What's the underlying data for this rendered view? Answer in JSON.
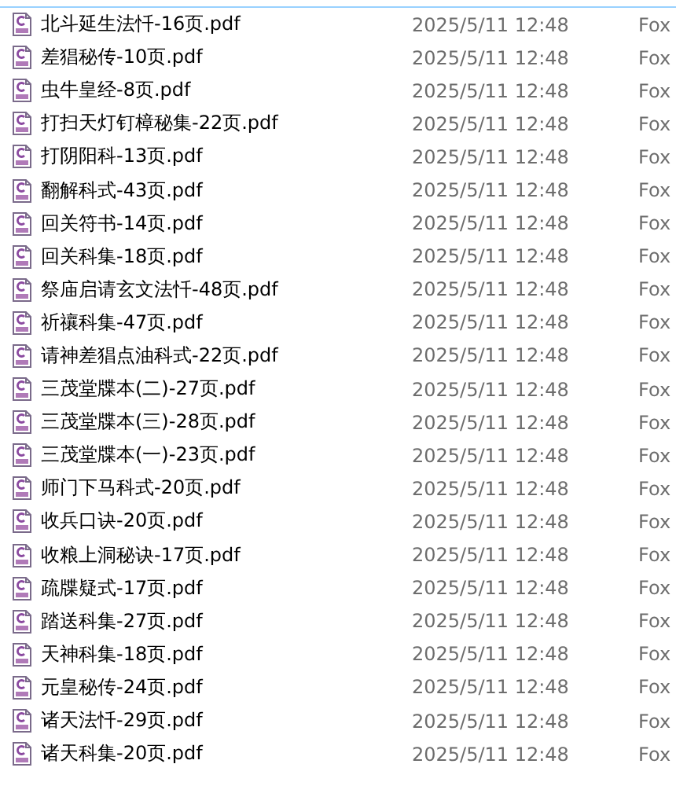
{
  "files": [
    {
      "name": "北斗延生法忏-16页.pdf",
      "modified": "2025/5/11 12:48",
      "type": "Fox"
    },
    {
      "name": "差猖秘传-10页.pdf",
      "modified": "2025/5/11 12:48",
      "type": "Fox"
    },
    {
      "name": "虫牛皇经-8页.pdf",
      "modified": "2025/5/11 12:48",
      "type": "Fox"
    },
    {
      "name": "打扫天灯钉樟秘集-22页.pdf",
      "modified": "2025/5/11 12:48",
      "type": "Fox"
    },
    {
      "name": "打阴阳科-13页.pdf",
      "modified": "2025/5/11 12:48",
      "type": "Fox"
    },
    {
      "name": "翻解科式-43页.pdf",
      "modified": "2025/5/11 12:48",
      "type": "Fox"
    },
    {
      "name": "回关符书-14页.pdf",
      "modified": "2025/5/11 12:48",
      "type": "Fox"
    },
    {
      "name": "回关科集-18页.pdf",
      "modified": "2025/5/11 12:48",
      "type": "Fox"
    },
    {
      "name": "祭庙启请玄文法忏-48页.pdf",
      "modified": "2025/5/11 12:48",
      "type": "Fox"
    },
    {
      "name": "祈禳科集-47页.pdf",
      "modified": "2025/5/11 12:48",
      "type": "Fox"
    },
    {
      "name": "请神差猖点油科式-22页.pdf",
      "modified": "2025/5/11 12:48",
      "type": "Fox"
    },
    {
      "name": "三茂堂牒本(二)-27页.pdf",
      "modified": "2025/5/11 12:48",
      "type": "Fox"
    },
    {
      "name": "三茂堂牒本(三)-28页.pdf",
      "modified": "2025/5/11 12:48",
      "type": "Fox"
    },
    {
      "name": "三茂堂牒本(一)-23页.pdf",
      "modified": "2025/5/11 12:48",
      "type": "Fox"
    },
    {
      "name": "师门下马科式-20页.pdf",
      "modified": "2025/5/11 12:48",
      "type": "Fox"
    },
    {
      "name": "收兵口诀-20页.pdf",
      "modified": "2025/5/11 12:48",
      "type": "Fox"
    },
    {
      "name": "收粮上洞秘诀-17页.pdf",
      "modified": "2025/5/11 12:48",
      "type": "Fox"
    },
    {
      "name": "疏牒疑式-17页.pdf",
      "modified": "2025/5/11 12:48",
      "type": "Fox"
    },
    {
      "name": "踏送科集-27页.pdf",
      "modified": "2025/5/11 12:48",
      "type": "Fox"
    },
    {
      "name": "天神科集-18页.pdf",
      "modified": "2025/5/11 12:48",
      "type": "Fox"
    },
    {
      "name": "元皇秘传-24页.pdf",
      "modified": "2025/5/11 12:48",
      "type": "Fox"
    },
    {
      "name": "诸天法忏-29页.pdf",
      "modified": "2025/5/11 12:48",
      "type": "Fox"
    },
    {
      "name": "诸天科集-20页.pdf",
      "modified": "2025/5/11 12:48",
      "type": "Fox"
    }
  ]
}
